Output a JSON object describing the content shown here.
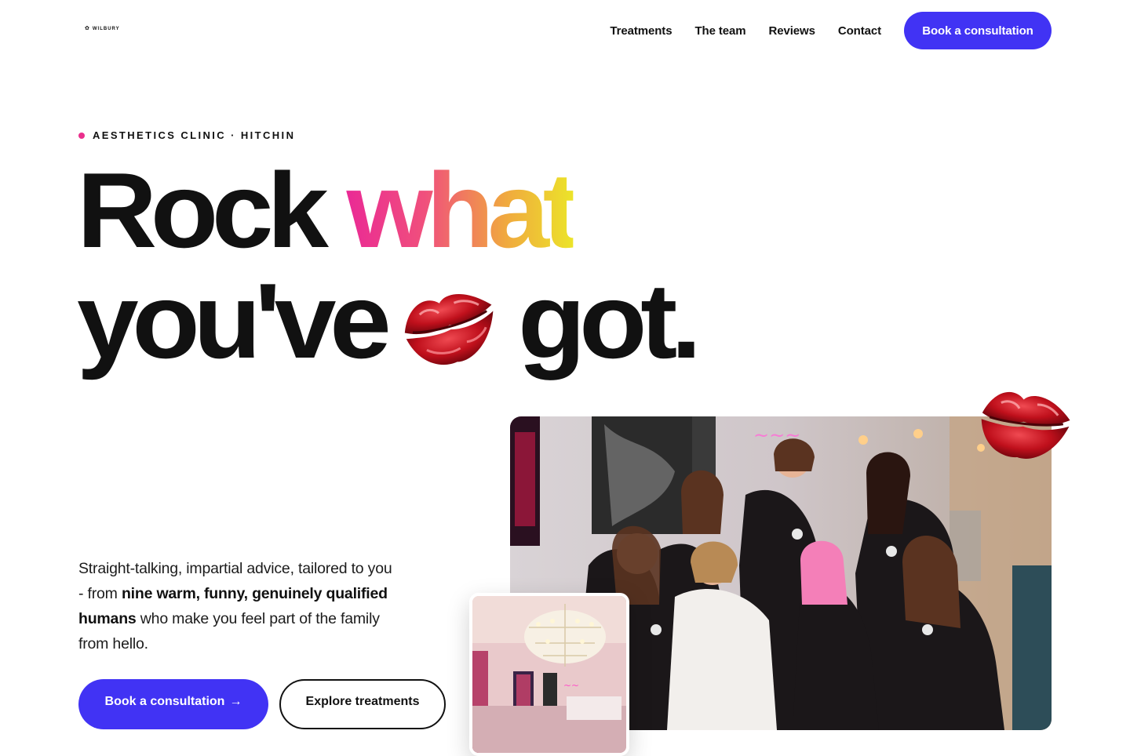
{
  "header": {
    "logo_text": "WILBURY",
    "logo_icon": "flower-icon",
    "nav": [
      {
        "label": "Treatments"
      },
      {
        "label": "The team"
      },
      {
        "label": "Reviews"
      },
      {
        "label": "Contact"
      }
    ],
    "cta_label": "Book a consultation"
  },
  "hero": {
    "eyebrow": "AESTHETICS CLINIC · HITCHIN",
    "headline": {
      "line1_a": "Rock ",
      "line1_b": "what",
      "line2_a": "you've",
      "line2_b": "got."
    },
    "intro": {
      "part1": "Straight-talking, impartial advice, tailored to you - from ",
      "bold": "nine warm, funny, genuinely qualified humans",
      "part2": " who make you feel part of the family from hello."
    },
    "primary_cta": "Book a consultation",
    "primary_cta_arrow": "→",
    "secondary_cta": "Explore treatments"
  },
  "colors": {
    "accent": "#4133f4",
    "eyebrow_dot": "#ea2f8c",
    "gradient": [
      "#ea2a95",
      "#f0a83f",
      "#ece429"
    ],
    "lips": "#c0101c"
  },
  "images": {
    "team_photo": "team-photo",
    "salon_photo": "salon-chandelier-photo",
    "lips_icon": "lips-kiss-icon"
  }
}
